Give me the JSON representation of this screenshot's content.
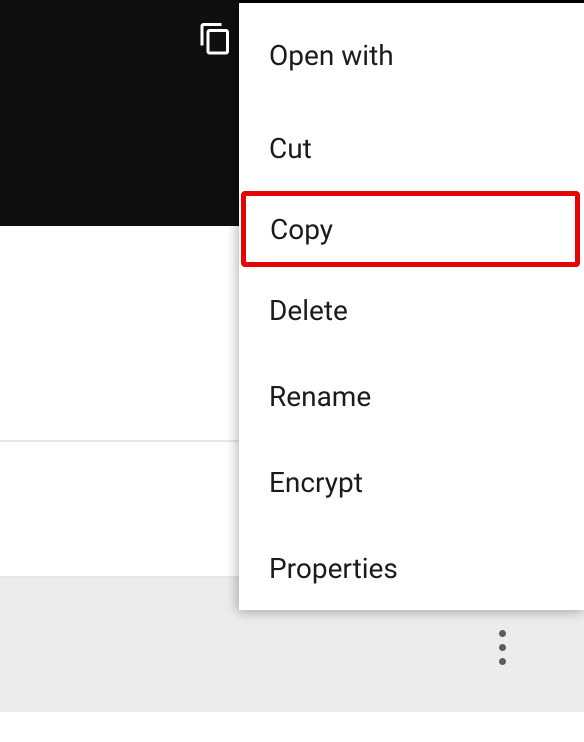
{
  "menu": {
    "items": [
      {
        "label": "Open with",
        "name": "menu-item-open-with",
        "highlight": false
      },
      {
        "label": "Cut",
        "name": "menu-item-cut",
        "highlight": false
      },
      {
        "label": "Copy",
        "name": "menu-item-copy",
        "highlight": true
      },
      {
        "label": "Delete",
        "name": "menu-item-delete",
        "highlight": false
      },
      {
        "label": "Rename",
        "name": "menu-item-rename",
        "highlight": false
      },
      {
        "label": "Encrypt",
        "name": "menu-item-encrypt",
        "highlight": false
      },
      {
        "label": "Properties",
        "name": "menu-item-properties",
        "highlight": false
      }
    ]
  }
}
